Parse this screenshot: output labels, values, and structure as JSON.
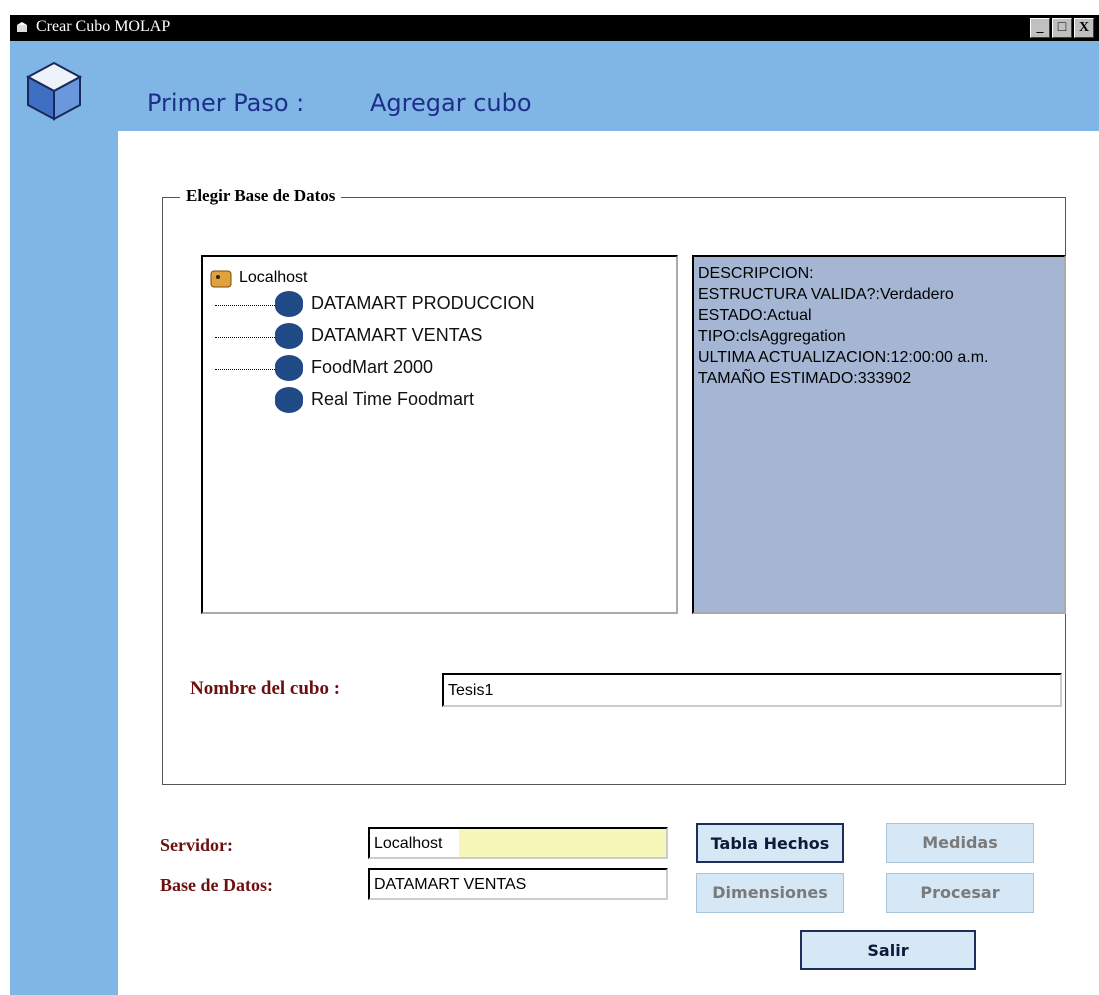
{
  "window": {
    "title": "Crear Cubo MOLAP",
    "controls": [
      "minimize-icon",
      "maximize-icon",
      "close-icon"
    ]
  },
  "header": {
    "step_label": "Primer Paso :",
    "step_title": "Agregar cubo"
  },
  "database_group": {
    "legend": "Elegir Base de Datos",
    "tree": {
      "root": "Localhost",
      "items": [
        "DATAMART PRODUCCION",
        "DATAMART VENTAS",
        "FoodMart 2000",
        "Real Time Foodmart"
      ]
    },
    "description": [
      "DESCRIPCION:",
      "ESTRUCTURA VALIDA?:Verdadero",
      "ESTADO:Actual",
      "TIPO:clsAggregation",
      "ULTIMA ACTUALIZACION:12:00:00 a.m.",
      "TAMAÑO ESTIMADO:333902"
    ],
    "cube_name_label": "Nombre del cubo :",
    "cube_name_value": "Tesis1"
  },
  "footer": {
    "server_label": "Servidor:",
    "server_value": "Localhost",
    "db_label": "Base de Datos:",
    "db_value": "DATAMART VENTAS"
  },
  "buttons": {
    "tabla_hechos": "Tabla Hechos",
    "medidas": "Medidas",
    "dimensiones": "Dimensiones",
    "procesar": "Procesar",
    "salir": "Salir"
  },
  "colors": {
    "accent_blue": "#7fb6e6",
    "desc_bg": "#a4b6d4",
    "label_red": "#6e0f0f",
    "heading_blue": "#1e2f8a"
  }
}
